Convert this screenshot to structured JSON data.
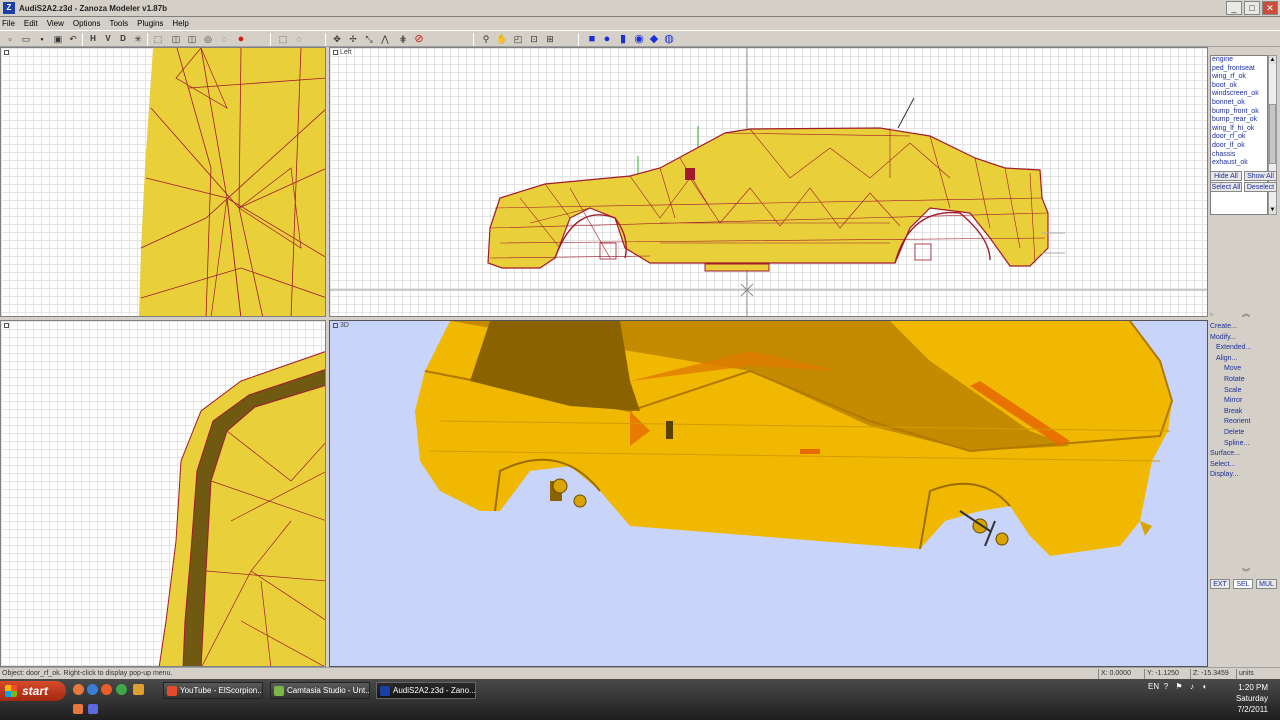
{
  "window": {
    "title": "AudiS2A2.z3d - Zanoza Modeler v1.87b",
    "app_icon": "Z",
    "buttons": {
      "minimize": "_",
      "maximize": "□",
      "close": "✕"
    }
  },
  "menubar": [
    "File",
    "Edit",
    "View",
    "Options",
    "Tools",
    "Plugins",
    "Help"
  ],
  "toolbar": {
    "file_icons": [
      "new-file-icon",
      "open-folder-icon",
      "save-icon",
      "save-as-icon",
      "undo-icon"
    ],
    "view_axis_labels": [
      "H",
      "V",
      "D"
    ],
    "tool_icons": [
      "select-icon",
      "gizmo-icon",
      "box-icon",
      "box-icon",
      "box-icon",
      "cylinder-icon",
      "sphere-icon",
      "marquee-icon",
      "lasso-icon",
      "scale-icon",
      "move-icon",
      "rotate-icon",
      "snap-icon",
      "mirror-icon",
      "zoom-icon",
      "pan-icon",
      "zoom-extents-icon",
      "zoom-region-icon",
      "grid-icon",
      "render-icon"
    ]
  },
  "viewports": {
    "top_left_label": "",
    "left_label": "Left",
    "bottom_left_label": "",
    "perspective_label": "3D"
  },
  "object_list": {
    "items": [
      "engine",
      "ped_frontseat",
      "wing_rf_ok",
      "boot_ok",
      "windscreen_ok",
      "bonnet_ok",
      "bump_front_ok",
      "bump_rear_ok",
      "wing_lf_hi_ok",
      "door_rf_ok",
      "door_lf_ok",
      "chassis",
      "exhaust_ok"
    ],
    "hide_all": "Hide All",
    "show_all": "Show All",
    "select_all": "Select All",
    "deselect": "Deselect"
  },
  "command_panel": {
    "items": [
      {
        "label": "Create...",
        "level": 0
      },
      {
        "label": "Modify...",
        "level": 0
      },
      {
        "label": "Extended...",
        "level": 1
      },
      {
        "label": "Align...",
        "level": 1
      },
      {
        "label": "Move",
        "level": 2
      },
      {
        "label": "Rotate",
        "level": 2
      },
      {
        "label": "Scale",
        "level": 2
      },
      {
        "label": "Mirror",
        "level": 2
      },
      {
        "label": "Break",
        "level": 2
      },
      {
        "label": "Reorient",
        "level": 2
      },
      {
        "label": "Delete",
        "level": 2
      },
      {
        "label": "Spline...",
        "level": 2
      },
      {
        "label": "Surface...",
        "level": 0
      },
      {
        "label": "Select...",
        "level": 0
      },
      {
        "label": "Display...",
        "level": 0
      }
    ],
    "mode_buttons": [
      "EXT",
      "SEL",
      "MUL"
    ]
  },
  "statusbar": {
    "message": "Object: door_rf_ok. Right-click to display pop-up menu.",
    "x": "X: 0.0000",
    "y": "Y: -1.1250",
    "z": "Z: -15.3459",
    "units": "units"
  },
  "taskbar": {
    "start_label": "start",
    "tasks": [
      {
        "label": "YouTube - ElScorpion...",
        "color": "#e34b2b"
      },
      {
        "label": "Camtasia Studio - Unt...",
        "color": "#7bb547"
      },
      {
        "label": "AudiS2A2.z3d - Zano...",
        "color": "#1b3fa6"
      }
    ],
    "tray_icons": [
      "EN",
      "?",
      "⚑",
      "♪",
      "◐"
    ],
    "time": "1:20 PM",
    "day": "Saturday",
    "date": "7/2/2011"
  },
  "colors": {
    "mesh_fill": "#e9cf3a",
    "wire": "#a01a2c",
    "viewport_3d_bg": "#c9d4fa",
    "car_3d": "#f0b800"
  }
}
